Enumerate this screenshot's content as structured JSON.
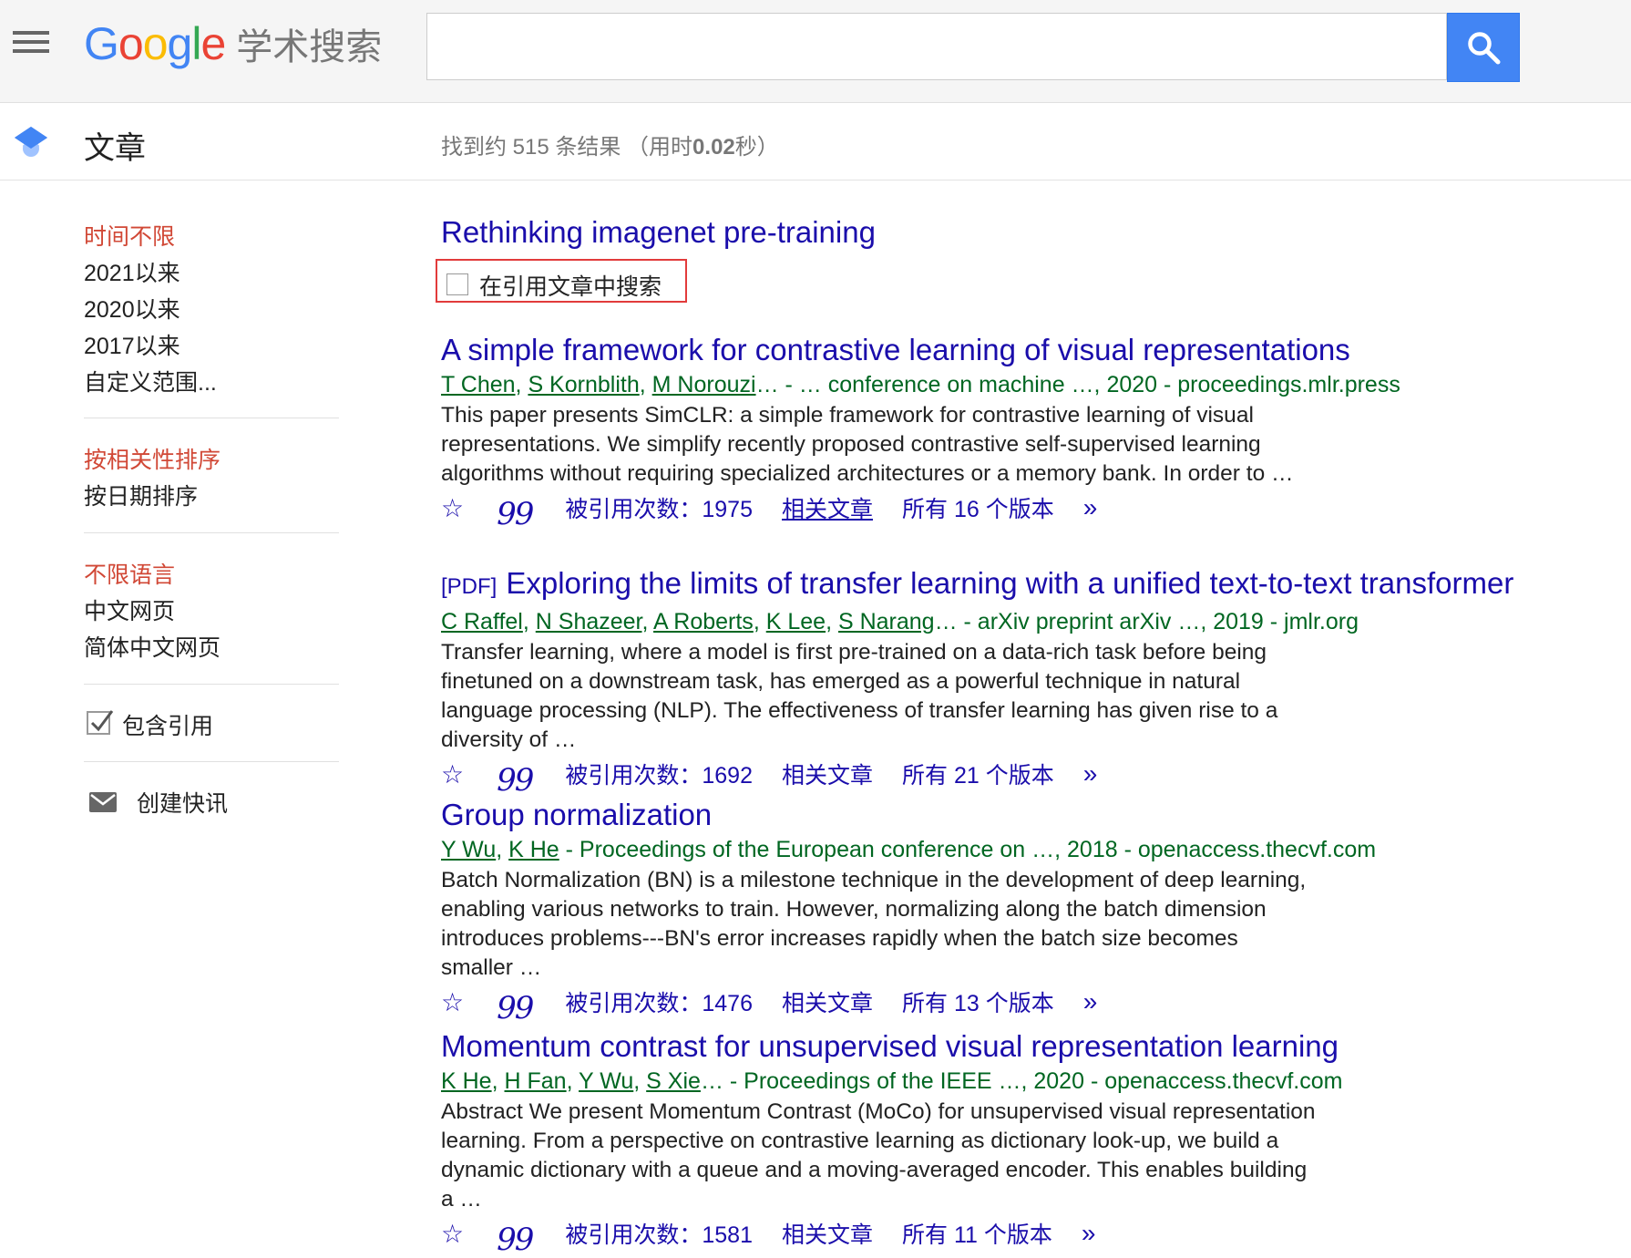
{
  "header": {
    "logo_text": "Google",
    "logo_subtitle": "学术搜索",
    "search_value": "",
    "accent_color": "#4285f4"
  },
  "subheader": {
    "section_title": "文章",
    "result_count_prefix": "找到约 515 条结果 （用时",
    "result_time": "0.02",
    "result_count_suffix": "秒）"
  },
  "sidebar": {
    "time_filters": [
      "时间不限",
      "2021以来",
      "2020以来",
      "2017以来",
      "自定义范围..."
    ],
    "sort_options": [
      "按相关性排序",
      "按日期排序"
    ],
    "language_filters": [
      "不限语言",
      "中文网页",
      "简体中文网页"
    ],
    "include_citations_label": "包含引用",
    "include_citations_checked": true,
    "create_alert_label": "创建快讯",
    "active_color": "#d14836"
  },
  "cited_article": {
    "title": "Rethinking imagenet pre-training",
    "search_within_label": "在引用文章中搜索"
  },
  "results": [
    {
      "pdf_tag": "",
      "title": "A simple framework for contrastive learning of visual representations",
      "authors": [
        "T Chen",
        "S Kornblith",
        "M Norouzi"
      ],
      "author_seps": [
        ", ",
        ", ",
        ""
      ],
      "meta_suffix": "… - … conference on machine …, 2020 - proceedings.mlr.press",
      "snippet": "This paper presents SimCLR: a simple framework for contrastive learning of visual representations. We simplify recently proposed contrastive self-supervised learning algorithms without requiring specialized architectures or a memory bank. In order to …",
      "cited_by": "被引用次数：1975",
      "related": "相关文章",
      "versions": "所有 16 个版本"
    },
    {
      "pdf_tag": "[PDF]",
      "title": "Exploring the limits of transfer learning with a unified text-to-text transformer",
      "authors": [
        "C Raffel",
        "N Shazeer",
        "A Roberts",
        "K Lee",
        "S Narang"
      ],
      "author_seps": [
        ", ",
        ", ",
        ", ",
        ", ",
        ""
      ],
      "meta_suffix": "… - arXiv preprint arXiv …, 2019 - jmlr.org",
      "snippet": "Transfer learning, where a model is first pre-trained on a data-rich task before being finetuned on a downstream task, has emerged as a powerful technique in natural language processing (NLP). The effectiveness of transfer learning has given rise to a diversity of …",
      "cited_by": "被引用次数：1692",
      "related": "相关文章",
      "versions": "所有 21 个版本"
    },
    {
      "pdf_tag": "",
      "title": "Group normalization",
      "authors": [
        "Y Wu",
        "K He"
      ],
      "author_seps": [
        ", ",
        ""
      ],
      "meta_suffix": " - Proceedings of the European conference on …, 2018 - openaccess.thecvf.com",
      "snippet": "Batch Normalization (BN) is a milestone technique in the development of deep learning, enabling various networks to train. However, normalizing along the batch dimension introduces problems---BN's error increases rapidly when the batch size becomes smaller …",
      "cited_by": "被引用次数：1476",
      "related": "相关文章",
      "versions": "所有 13 个版本"
    },
    {
      "pdf_tag": "",
      "title": "Momentum contrast for unsupervised visual representation learning",
      "authors": [
        "K He",
        "H Fan",
        "Y Wu",
        "S Xie"
      ],
      "author_seps": [
        ", ",
        ", ",
        ", ",
        ""
      ],
      "meta_suffix": "… - Proceedings of the IEEE …, 2020 - openaccess.thecvf.com",
      "snippet": "Abstract We present Momentum Contrast (MoCo) for unsupervised visual representation learning. From a perspective on contrastive learning as dictionary look-up, we build a dynamic dictionary with a queue and a moving-averaged encoder. This enables building a …",
      "cited_by": "被引用次数：1581",
      "related": "相关文章",
      "versions": "所有 11 个版本"
    }
  ]
}
